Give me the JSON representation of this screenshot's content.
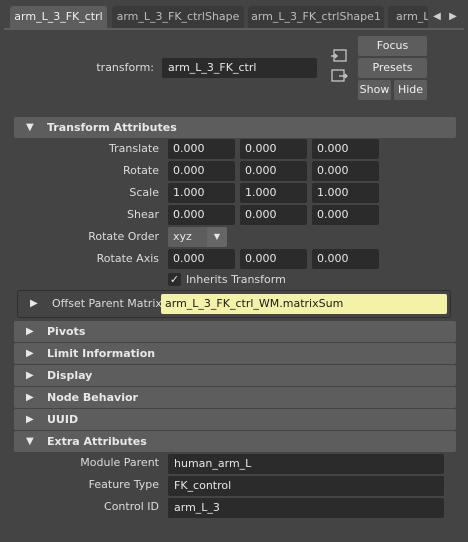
{
  "tabs": [
    {
      "label": "arm_L_3_FK_ctrl",
      "active": true
    },
    {
      "label": "arm_L_3_FK_ctrlShape",
      "active": false
    },
    {
      "label": "arm_L_3_FK_ctrlShape1",
      "active": false
    },
    {
      "label": "arm_L",
      "active": false
    }
  ],
  "tab_nav": {
    "prev_icon": "arrow-left-icon",
    "next_icon": "arrow-right-icon"
  },
  "node": {
    "transform_label": "transform:",
    "transform_value": "arm_L_3_FK_ctrl",
    "focus_label": "Focus",
    "presets_label": "Presets",
    "show_label": "Show",
    "hide_label": "Hide"
  },
  "sections": {
    "transform_attributes": "Transform Attributes",
    "pivots": "Pivots",
    "limit_information": "Limit Information",
    "display": "Display",
    "node_behavior": "Node Behavior",
    "uuid": "UUID",
    "extra_attributes": "Extra Attributes"
  },
  "transform": {
    "translate": {
      "label": "Translate",
      "x": "0.000",
      "y": "0.000",
      "z": "0.000"
    },
    "rotate": {
      "label": "Rotate",
      "x": "0.000",
      "y": "0.000",
      "z": "0.000"
    },
    "scale": {
      "label": "Scale",
      "x": "1.000",
      "y": "1.000",
      "z": "1.000"
    },
    "shear": {
      "label": "Shear",
      "x": "0.000",
      "y": "0.000",
      "z": "0.000"
    },
    "rotate_order": {
      "label": "Rotate Order",
      "value": "xyz"
    },
    "rotate_axis": {
      "label": "Rotate Axis",
      "x": "0.000",
      "y": "0.000",
      "z": "0.000"
    },
    "inherits_transform": {
      "label": "Inherits Transform",
      "checked": true,
      "check_glyph": "✓"
    },
    "offset_parent_matrix": {
      "label": "Offset Parent Matrix",
      "value": "arm_L_3_FK_ctrl_WM.matrixSum"
    }
  },
  "extra": {
    "module_parent": {
      "label": "Module Parent",
      "value": "human_arm_L"
    },
    "feature_type": {
      "label": "Feature Type",
      "value": "FK_control"
    },
    "control_id": {
      "label": "Control ID",
      "value": "arm_L_3"
    }
  },
  "glyphs": {
    "expanded": "▼",
    "collapsed": "▶",
    "dropdown": "▼",
    "tab_left": "◀",
    "tab_right": "▶"
  },
  "colors": {
    "panel_bg": "#444444",
    "frame_header": "#5d5d5d",
    "field_bg": "#2b2b2b",
    "connected_field": "#f4f1a9"
  }
}
